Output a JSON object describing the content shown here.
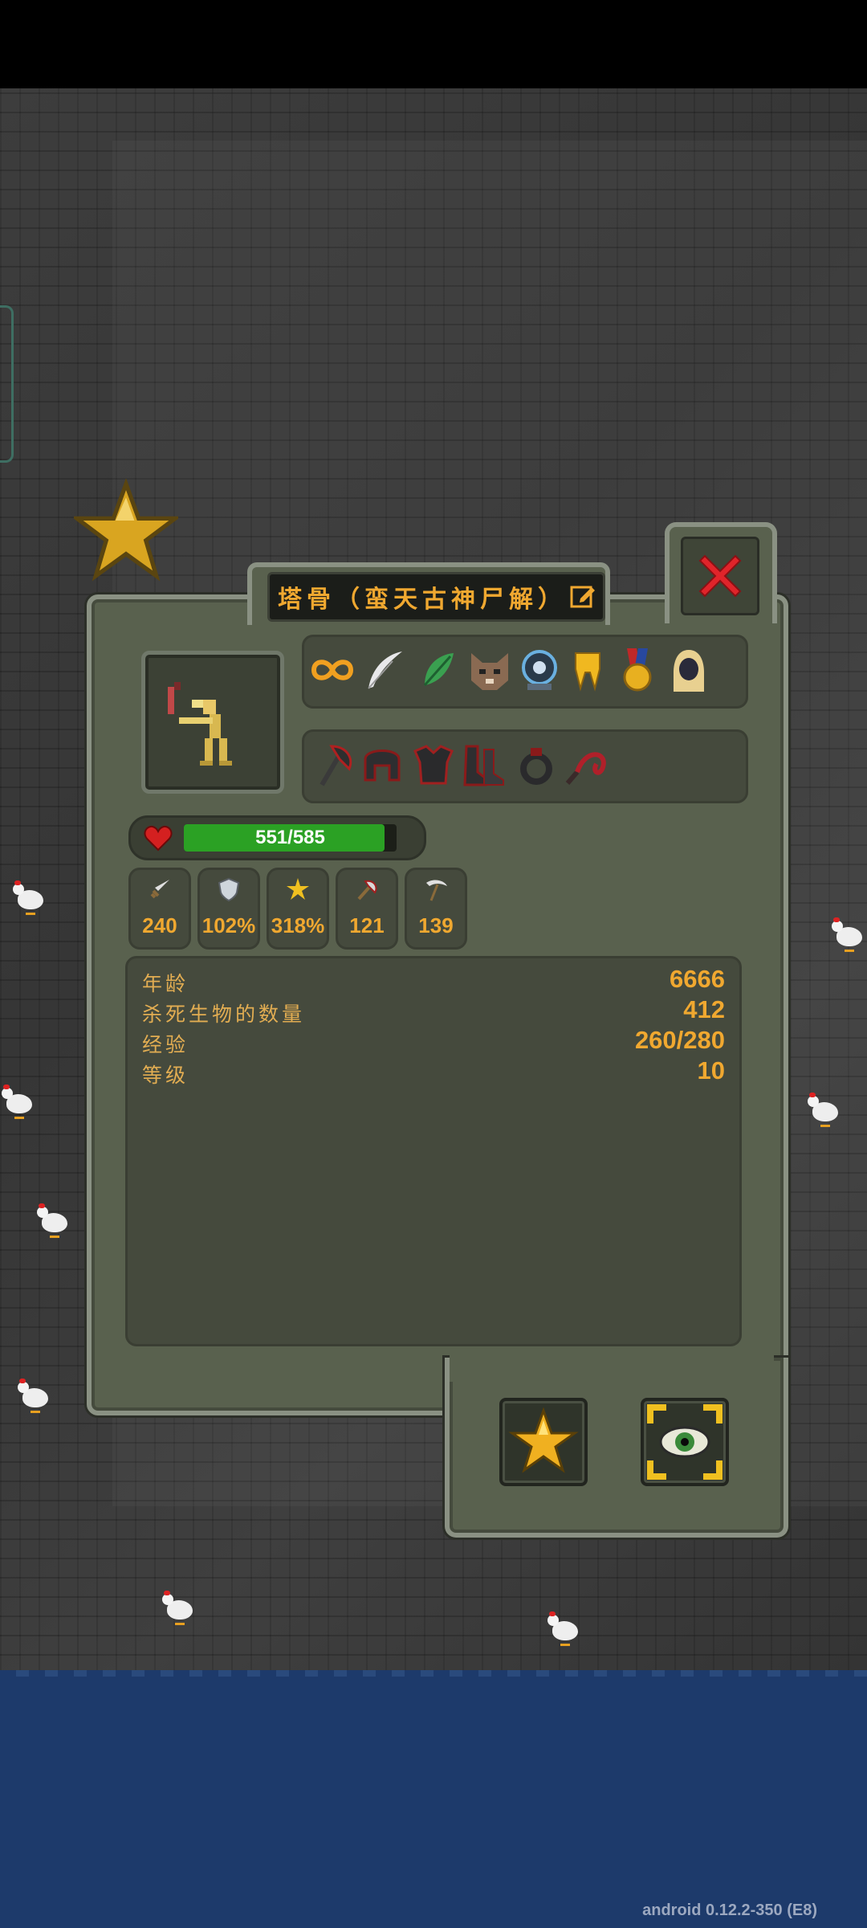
{
  "colors": {
    "accent": "#f0a830",
    "hp": "#2ba124",
    "frame": "#59614e",
    "water": "#1d3a6b"
  },
  "dialog": {
    "title": "塔骨（蛮天古神尸解）",
    "hp": {
      "text": "551/585",
      "current": 551,
      "max": 585
    },
    "equipment_top": [
      "infinity-icon",
      "feather-icon",
      "green-leaf-icon",
      "cat-mask-icon",
      "blue-orb-icon",
      "golden-tooth-icon",
      "medal-icon",
      "hooded-figure-icon"
    ],
    "equipment_bottom": [
      "dark-axe-icon",
      "dark-helmet-icon",
      "dark-armor-icon",
      "dark-boots-icon",
      "dark-ring-icon",
      "red-whip-icon"
    ],
    "stats": [
      {
        "icon": "sword-icon",
        "value": "240"
      },
      {
        "icon": "shield-icon",
        "value": "102%"
      },
      {
        "icon": "star-burst-icon",
        "value": "318%"
      },
      {
        "icon": "axe-icon",
        "value": "121"
      },
      {
        "icon": "scythe-icon",
        "value": "139"
      }
    ],
    "info": [
      {
        "label": "年龄",
        "value": "6666"
      },
      {
        "label": "杀死生物的数量",
        "value": "412"
      },
      {
        "label": "经验",
        "value": "260/280"
      },
      {
        "label": "等级",
        "value": "10"
      }
    ]
  },
  "version": "android 0.12.2-350 (E8)"
}
